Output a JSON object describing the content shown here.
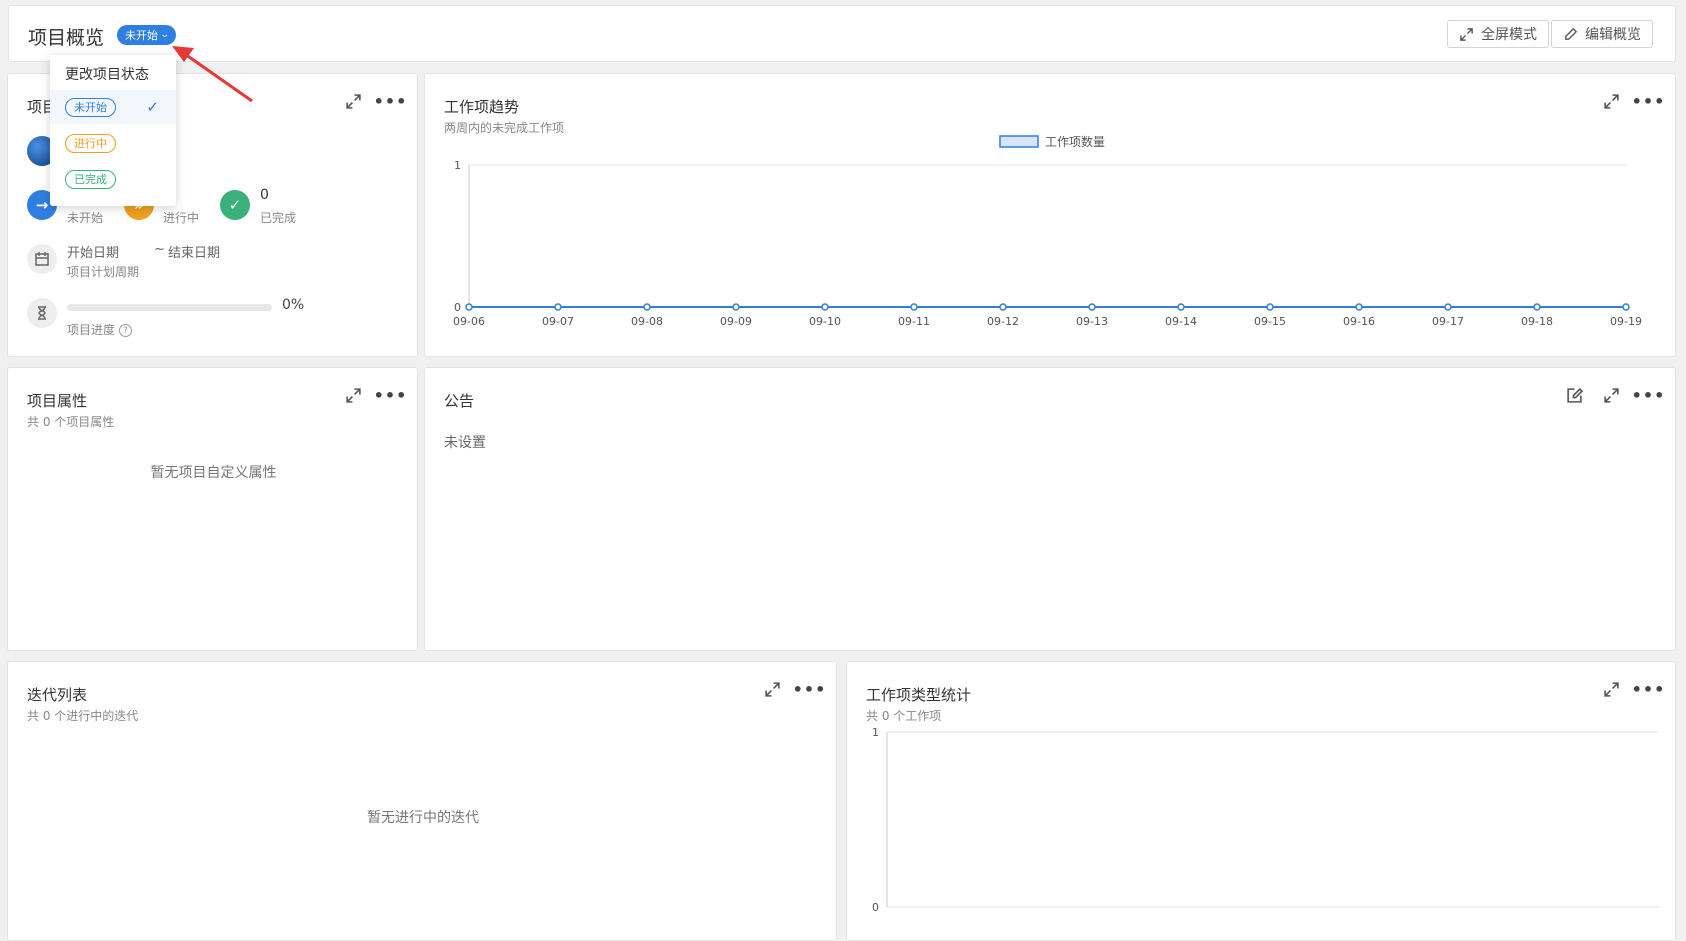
{
  "header": {
    "title": "项目概览",
    "status": "未开始",
    "fullscreen_label": "全屏模式",
    "edit_label": "编辑概览"
  },
  "status_menu": {
    "title": "更改项目状态",
    "options": [
      {
        "label": "未开始",
        "color": "#2f7fe0",
        "selected": true
      },
      {
        "label": "进行中",
        "color": "#f0a020",
        "selected": false
      },
      {
        "label": "已完成",
        "color": "#3ab07a",
        "selected": false
      }
    ]
  },
  "project_card": {
    "title_visible": "项目",
    "stats": [
      {
        "label": "未开始",
        "color": "#2f7fe0",
        "icon": "arrow-right-icon"
      },
      {
        "label": "进行中",
        "color": "#f0a020",
        "icon": "double-chevron-icon"
      },
      {
        "value": "0",
        "label": "已完成",
        "color": "#3ab07a",
        "icon": "check-icon"
      }
    ],
    "start_label": "开始日期",
    "separator": "~",
    "end_label": "结束日期",
    "period_label": "项目计划周期",
    "progress_percent": "0%",
    "progress_value": 0,
    "progress_label": "项目进度",
    "help_glyph": "?"
  },
  "trend_card": {
    "title": "工作项趋势",
    "subtitle": "两周内的未完成工作项"
  },
  "attributes_card": {
    "title": "项目属性",
    "subtitle": "共 0 个项目属性",
    "empty": "暂无项目自定义属性"
  },
  "notice_card": {
    "title": "公告",
    "content": "未设置"
  },
  "iteration_card": {
    "title": "迭代列表",
    "subtitle": "共 0 个进行中的迭代",
    "empty": "暂无进行中的迭代"
  },
  "type_card": {
    "title": "工作项类型统计",
    "subtitle": "共 0 个工作项"
  },
  "chart_data": [
    {
      "type": "line",
      "title": "",
      "series": [
        {
          "name": "工作项数量",
          "values": [
            0,
            0,
            0,
            0,
            0,
            0,
            0,
            0,
            0,
            0,
            0,
            0,
            0,
            0
          ]
        }
      ],
      "categories": [
        "09-06",
        "09-07",
        "09-08",
        "09-09",
        "09-10",
        "09-11",
        "09-12",
        "09-13",
        "09-14",
        "09-15",
        "09-16",
        "09-17",
        "09-18",
        "09-19"
      ],
      "ylim": [
        0,
        1
      ],
      "yticks": [
        "0",
        "1"
      ],
      "legend": "top-center",
      "color": "#2f7fe0"
    },
    {
      "type": "bar",
      "title": "",
      "categories": [],
      "values": [],
      "ylim": [
        0,
        1
      ],
      "yticks": [
        "0",
        "1"
      ]
    }
  ]
}
